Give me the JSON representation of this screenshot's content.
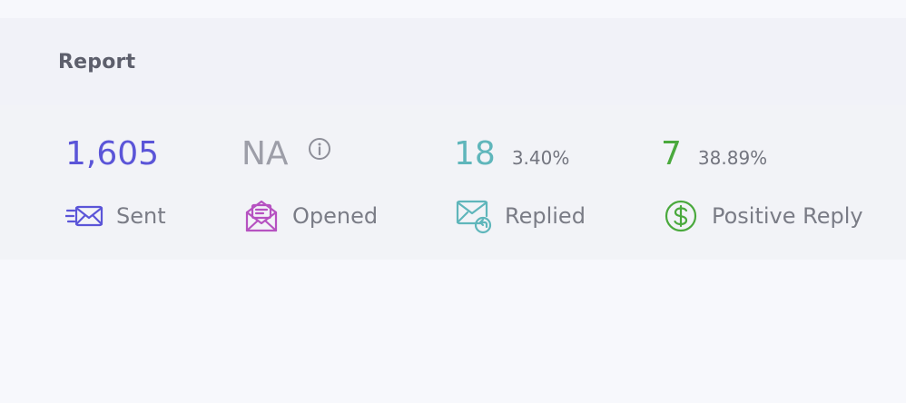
{
  "header": {
    "title": "Report"
  },
  "stats": {
    "sent": {
      "value": "1,605",
      "label": "Sent",
      "color": "#5b55d8",
      "icon": "sent-envelope-icon"
    },
    "opened": {
      "value": "NA",
      "label": "Opened",
      "color": "#9d9ea8",
      "icon": "open-envelope-icon",
      "info_icon": "info-icon",
      "icon_color": "#b652c1"
    },
    "replied": {
      "value": "18",
      "percent": "3.40%",
      "label": "Replied",
      "color": "#5fb6bb",
      "icon": "reply-envelope-icon"
    },
    "positive_reply": {
      "value": "7",
      "percent": "38.89%",
      "label": "Positive Reply",
      "color": "#4aa93d",
      "icon": "dollar-icon"
    }
  }
}
